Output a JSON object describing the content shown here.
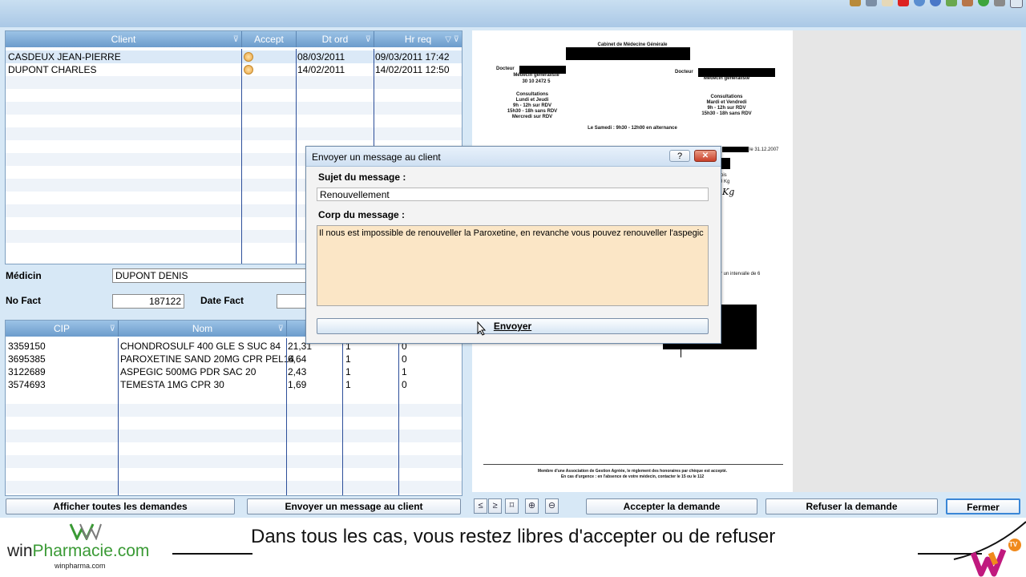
{
  "client_grid": {
    "headers": {
      "client": "Client",
      "accept": "Accept",
      "dt_ord": "Dt ord",
      "hr_req": "Hr req"
    },
    "rows": [
      {
        "client": "CASDEUX JEAN-PIERRE",
        "dt_ord": "08/03/2011",
        "hr_req": "09/03/2011 17:42"
      },
      {
        "client": "DUPONT CHARLES",
        "dt_ord": "14/02/2011",
        "hr_req": "14/02/2011 12:50"
      }
    ]
  },
  "form": {
    "medecin_label": "Médicin",
    "medecin_value": "DUPONT DENIS",
    "nofact_label": "No Fact",
    "nofact_value": "187122",
    "datefact_label": "Date Fact"
  },
  "product_grid": {
    "headers": {
      "cip": "CIP",
      "nom": "Nom"
    },
    "rows": [
      {
        "cip": "3359150",
        "nom": "CHONDROSULF 400 GLE S SUC   84",
        "price": "21,31",
        "qty": "1",
        "x": "0"
      },
      {
        "cip": "3695385",
        "nom": "PAROXETINE SAND 20MG CPR PEL14",
        "price": "6,64",
        "qty": "1",
        "x": "0"
      },
      {
        "cip": "3122689",
        "nom": "ASPEGIC   500MG   PDR SAC 20",
        "price": "2,43",
        "qty": "1",
        "x": "1"
      },
      {
        "cip": "3574693",
        "nom": "TEMESTA 1MG   CPR  30",
        "price": "1,69",
        "qty": "1",
        "x": "0"
      }
    ]
  },
  "buttons": {
    "show_all": "Afficher toutes les demandes",
    "send_message": "Envoyer un message au client",
    "accept": "Accepter la demande",
    "refuse": "Refuser la demande",
    "close": "Fermer",
    "prev": "≤",
    "next": "≥"
  },
  "document": {
    "cabinet": "Cabinet de Médecine Générale",
    "docteur_left": "Docteur",
    "docteur_right": "Docteur",
    "medecin_generaliste": "Médecin généraliste",
    "phone": "30 10 2472 5",
    "consult_left": [
      "Consultations",
      "Lundi et Jeudi",
      "9h - 12h sur RDV",
      "15h30 - 18h sans RDV",
      "Mercredi sur RDV"
    ],
    "consult_right": [
      "Consultations",
      "Mardi et Vendredi",
      "9h - 12h sur RDV",
      "15h30 - 18h sans RDV"
    ],
    "samedi": "Le Samedi : 9h30 - 12h00 en alternance",
    "date": "le 31.12.2007",
    "frag1": "ois",
    "frag2": "0 Kg",
    "frag3": "Kg",
    "interval": "r un intervalle de 6",
    "footer_line1": "Membre d'une Association de Gestion Agréée, le règlement des honoraires par chèque est accepté.",
    "footer_line2": "En cas d'urgence : en l'absence de votre médecin, contacter le 15 ou le 112"
  },
  "dialog": {
    "title": "Envoyer un message au client",
    "help": "?",
    "subject_label": "Sujet du message :",
    "subject_value": "Renouvellement",
    "body_label": "Corp du message :",
    "body_value": "Il nous est impossible de renouveller la Paroxetine, en revanche vous pouvez renouveller l'aspegic",
    "send": "Envoyer"
  },
  "footer": {
    "logo_win": "win",
    "logo_pharmacie": "Pharmacie.com",
    "logo_sub": "winpharma.com",
    "caption": "Dans tous les cas, vous restez libres d'accepter ou de refuser",
    "tv_badge": "TV"
  },
  "colors": {
    "header_blue": "#6c9ccc",
    "app_bg": "#d7e8f6",
    "message_bg": "#fbe6c6",
    "logo_green": "#3a9a35",
    "logo_orange": "#f08a1c",
    "logo_magenta": "#c0197e"
  }
}
